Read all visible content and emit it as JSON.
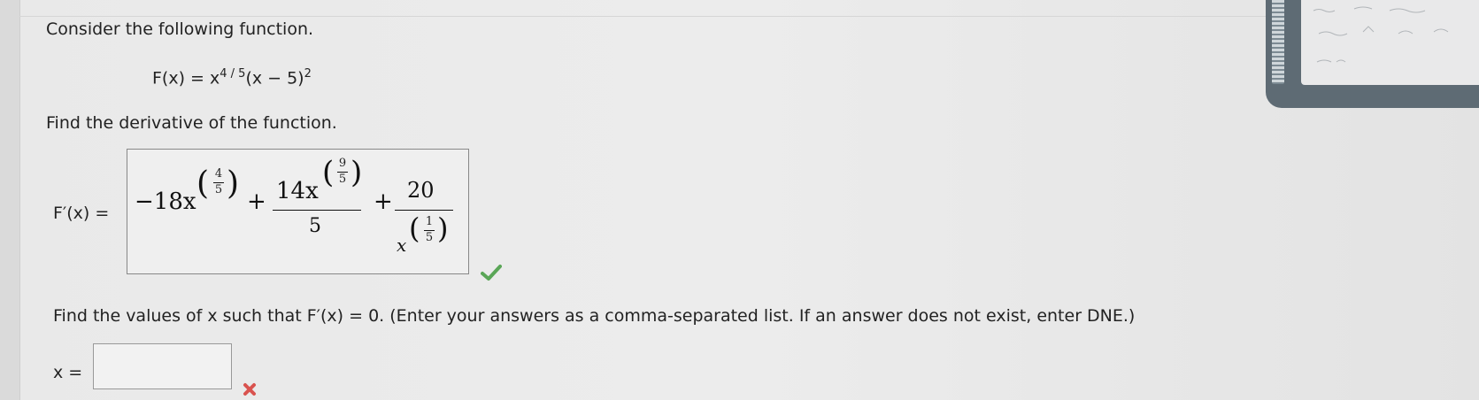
{
  "question": {
    "intro": "Consider the following function.",
    "function_lhs": "F(x) = x",
    "function_exp": "4 / 5",
    "function_rhs": "(x − 5)",
    "function_rhs_exp": "2",
    "derivative_prompt": "Find the derivative of the function.",
    "derivative_label": "F′(x) =",
    "zeros_prompt": "Find the values of x such that F′(x) = 0. (Enter your answers as a comma-separated list. If an answer does not exist, enter DNE.)",
    "x_label": "x ="
  },
  "answer": {
    "term1_coef": "−18x",
    "term1_exp_num": "4",
    "term1_exp_den": "5",
    "plus1": "+",
    "term2_num": "14x",
    "term2_exp_num": "9",
    "term2_exp_den": "5",
    "term2_den": "5",
    "plus2": "+",
    "term3_num": "20",
    "term3_den": "x",
    "term3_exp_num": "1",
    "term3_exp_den": "5",
    "status": "correct"
  },
  "zeros_input": {
    "value": "",
    "status": "incorrect"
  },
  "icons": {
    "check": "check-icon",
    "cross": "cross-icon"
  },
  "colors": {
    "check": "#5aa657",
    "cross": "#d9534f"
  }
}
